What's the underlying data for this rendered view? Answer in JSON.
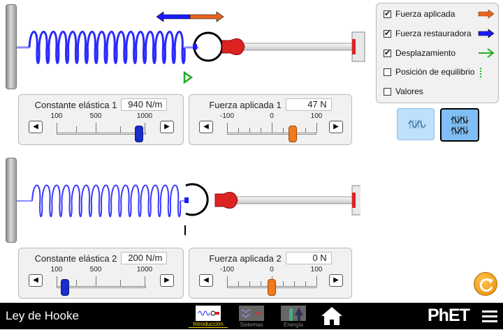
{
  "controls": {
    "spring1": {
      "k_label": "Constante elástica 1",
      "k_value": "940 N/m",
      "k_ticks": [
        "100",
        "500",
        "1000"
      ],
      "force_label": "Fuerza aplicada 1",
      "force_value": "47 N",
      "force_ticks": [
        "-100",
        "0",
        "100"
      ]
    },
    "spring2": {
      "k_label": "Constante elástica 2",
      "k_value": "200 N/m",
      "k_ticks": [
        "100",
        "500",
        "1000"
      ],
      "force_label": "Fuerza aplicada 2",
      "force_value": "0 N",
      "force_ticks": [
        "-100",
        "0",
        "100"
      ]
    }
  },
  "checkboxes": [
    {
      "label": "Fuerza aplicada",
      "checked": true,
      "indicator": "orange-arrow-icon"
    },
    {
      "label": "Fuerza restauradora",
      "checked": true,
      "indicator": "blue-arrow-icon"
    },
    {
      "label": "Desplazamiento",
      "checked": true,
      "indicator": "green-arrow-icon"
    },
    {
      "label": "Posición de equilibrio",
      "checked": false,
      "indicator": "green-dotted-line-icon"
    },
    {
      "label": "Valores",
      "checked": false,
      "indicator": ""
    }
  ],
  "scene_buttons": {
    "selected": "two-springs",
    "options": [
      "one-spring",
      "two-springs"
    ]
  },
  "navbar": {
    "title": "Ley de Hooke",
    "screens": [
      {
        "label": "Introducción",
        "active": true
      },
      {
        "label": "Sistemas",
        "active": false
      },
      {
        "label": "Energía",
        "active": false
      }
    ],
    "brand": "PhET"
  },
  "colors": {
    "applied_force": "#e8641e",
    "restoring_force": "#1a1aff",
    "displacement": "#22aa22",
    "spring1": "#2a2aff",
    "spring2": "#4a4aff",
    "reset_button": "#f2a216"
  }
}
